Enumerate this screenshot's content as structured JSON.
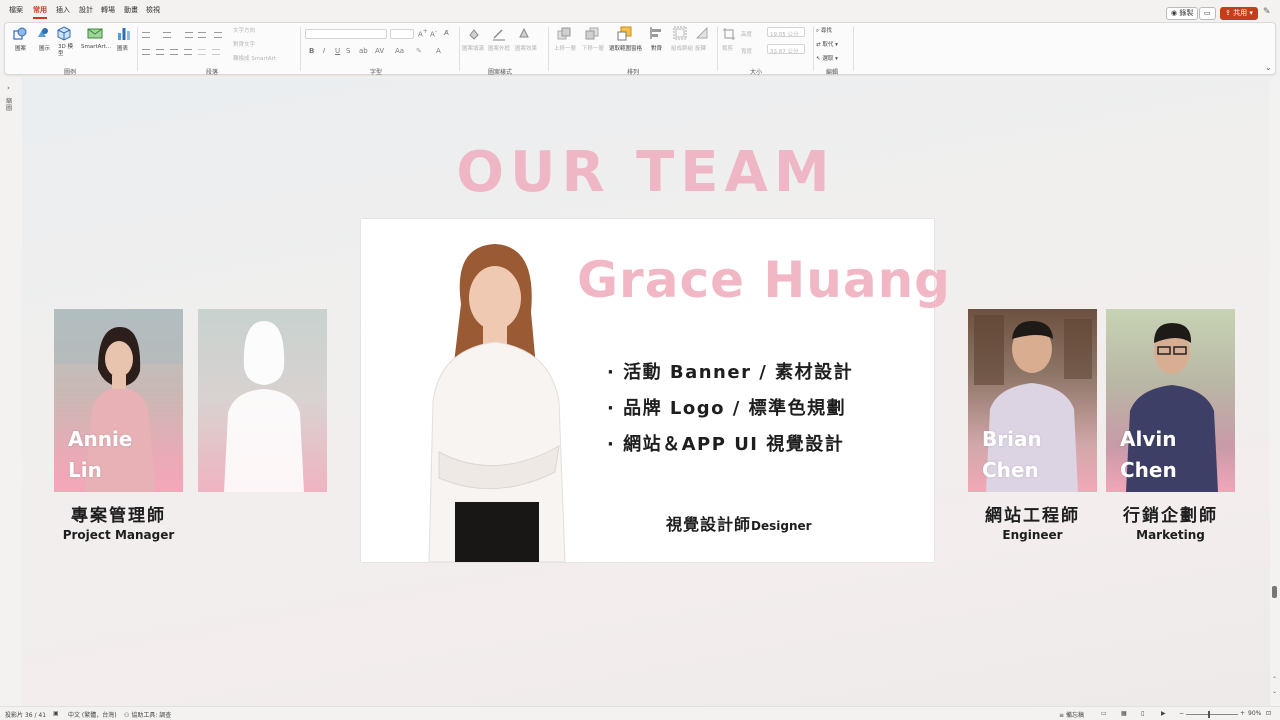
{
  "ribbon_tabs": [
    "檔案",
    "常用",
    "插入",
    "設計",
    "轉場",
    "動畫",
    "檢視"
  ],
  "active_tab": "常用",
  "top_right": {
    "record_label": "錄製",
    "share_label": "共用"
  },
  "ribbon": {
    "groups": {
      "shape_group": "圖例",
      "paragraph": "段落",
      "font": "字型",
      "graphic_style": "圖案樣式",
      "arrange": "排列",
      "size": "大小",
      "editing": "編輯"
    },
    "shape_buttons": [
      "圖案",
      "圖示",
      "3D 模型",
      "SmartArt...",
      "圖表"
    ],
    "paragraph_tools": [
      "文字方向",
      "對齊文字",
      "轉換成 SmartArt"
    ],
    "style_buttons": [
      "圖案填滿",
      "圖案外框",
      "圖案效果"
    ],
    "arrange_buttons": [
      "上移一層",
      "下移一層",
      "選取範圍窗格",
      "對齊",
      "組成群組",
      "旋轉"
    ],
    "size_fields": [
      {
        "label": "高度",
        "value": "19.05 公分"
      },
      {
        "label": "寬度",
        "value": "33.87 公分"
      }
    ],
    "size_crop": "裁剪",
    "editing_tools": [
      "尋找",
      "取代",
      "選取"
    ]
  },
  "slide": {
    "title": "OUR TEAM",
    "main": {
      "name": "Grace Huang",
      "skills": [
        "活動 Banner / 素材設計",
        "品牌 Logo / 標準色規劃",
        "網站＆APP UI 視覺設計"
      ],
      "role_zh": "視覺設計師",
      "role_en": "Designer"
    },
    "members": [
      {
        "first": "Annie",
        "last": "Lin",
        "role_zh": "專案管理師",
        "role_en": "Project Manager"
      },
      {
        "first": "",
        "last": "",
        "role_zh": "",
        "role_en": ""
      },
      {
        "first": "Brian",
        "last": "Chen",
        "role_zh": "網站工程師",
        "role_en": "Engineer"
      },
      {
        "first": "Alvin",
        "last": "Chen",
        "role_zh": "行銷企劃師",
        "role_en": "Marketing"
      }
    ]
  },
  "statusbar": {
    "slide_info": "投影片 36 / 41",
    "language": "中文 (繁體，台灣)",
    "accessibility": "協助工具: 調查",
    "notes": "備忘稿",
    "zoom": "90%"
  },
  "left_rail_label": "縮圖"
}
